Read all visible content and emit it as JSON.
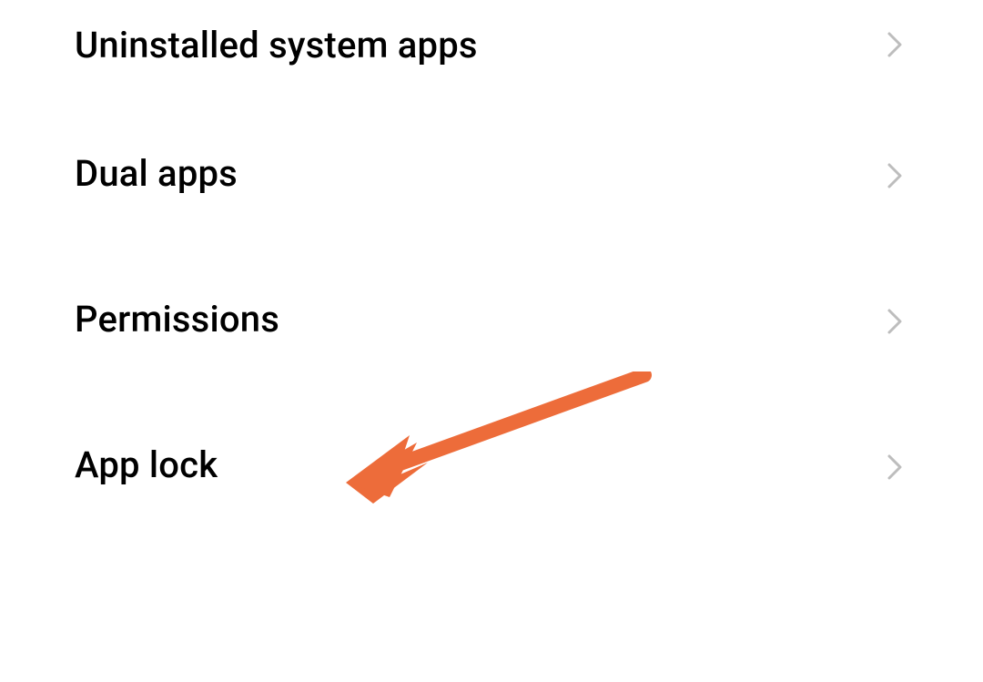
{
  "settings": {
    "items": [
      {
        "label": "Uninstalled system apps"
      },
      {
        "label": "Dual apps"
      },
      {
        "label": "Permissions"
      },
      {
        "label": "App lock"
      }
    ]
  },
  "annotation": {
    "color": "#ed6c3a",
    "target": "app-lock"
  }
}
